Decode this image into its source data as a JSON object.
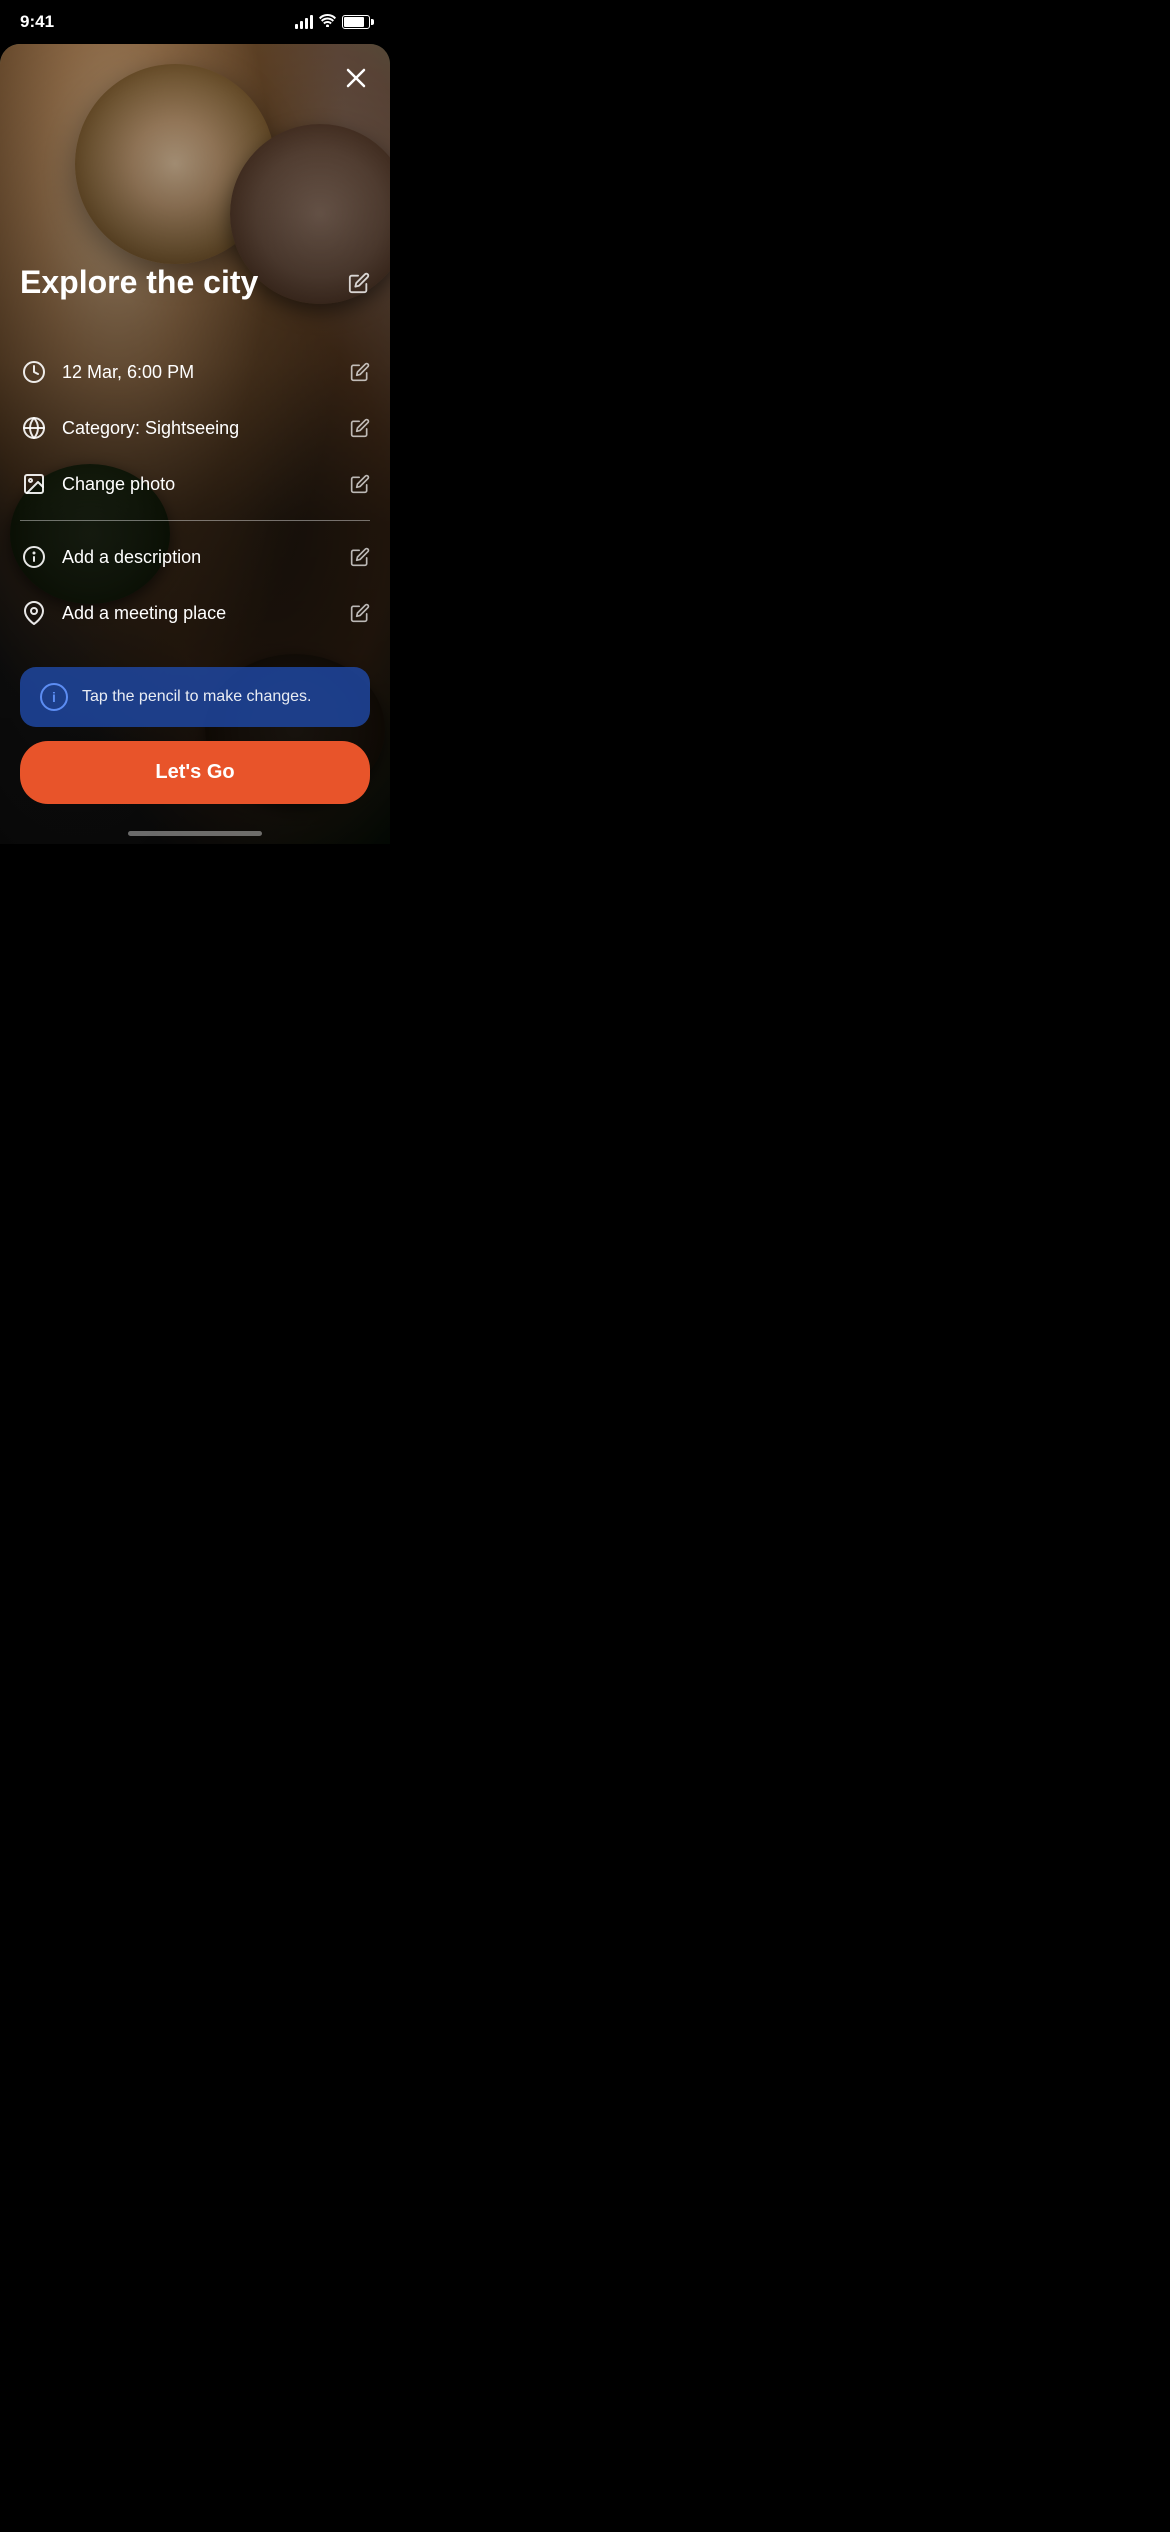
{
  "statusBar": {
    "time": "9:41"
  },
  "header": {
    "closeLabel": "×"
  },
  "event": {
    "title": "Explore the city",
    "datetime": "12 Mar, 6:00 PM",
    "category": "Category: Sightseeing",
    "changePhoto": "Change photo",
    "addDescription": "Add a description",
    "addMeetingPlace": "Add a meeting place"
  },
  "infoBanner": {
    "text": "Tap the pencil to make changes."
  },
  "cta": {
    "label": "Let's Go"
  }
}
